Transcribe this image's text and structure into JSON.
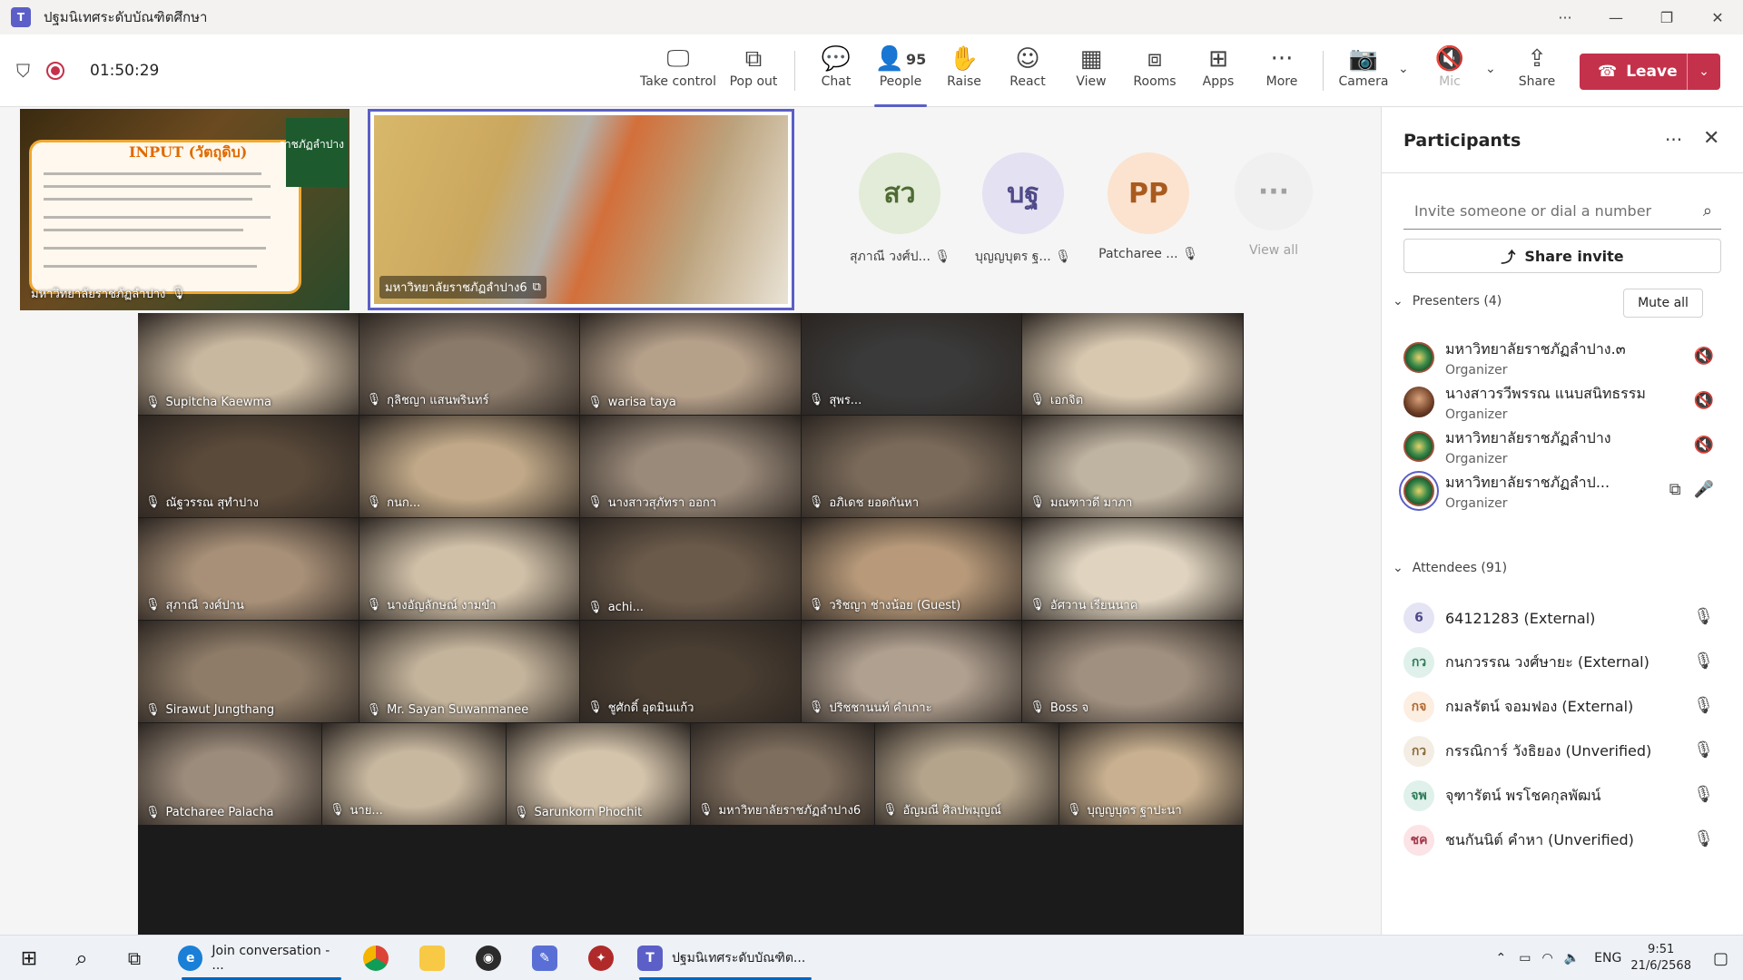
{
  "window": {
    "title": "ปฐมนิเทศระดับบัณฑิตศึกษา",
    "app_icon": "teams-icon"
  },
  "toolbar": {
    "timer": "01:50:29",
    "buttons": [
      {
        "label": "Take control",
        "icon": "take-control-icon"
      },
      {
        "label": "Pop out",
        "icon": "pop-out-icon"
      },
      {
        "label": "Chat",
        "icon": "chat-icon"
      },
      {
        "label": "People",
        "icon": "people-icon",
        "count": "95",
        "active": true
      },
      {
        "label": "Raise",
        "icon": "raise-hand-icon"
      },
      {
        "label": "React",
        "icon": "react-icon"
      },
      {
        "label": "View",
        "icon": "view-icon"
      },
      {
        "label": "Rooms",
        "icon": "rooms-icon"
      },
      {
        "label": "Apps",
        "icon": "apps-icon"
      },
      {
        "label": "More",
        "icon": "more-icon"
      },
      {
        "label": "Camera",
        "icon": "camera-off-icon"
      },
      {
        "label": "Mic",
        "icon": "mic-off-icon",
        "disabled": true
      },
      {
        "label": "Share",
        "icon": "share-icon"
      }
    ],
    "leave_label": "Leave"
  },
  "stage": {
    "share_tile": {
      "name": "มหาวิทยาลัยราชภัฏลำปาง",
      "slide_title": "INPUT (วัตถุดิบ)",
      "logo_text": "ราชภัฏลำปาง"
    },
    "main_tile": {
      "name": "มหาวิทยาลัยราชภัฏลำปาง6"
    },
    "avatar_tiles": [
      {
        "initials": "สว",
        "name": "สุภาณี วงศ์ป...",
        "bg": "#e3ecd8",
        "fg": "#4f6b34"
      },
      {
        "initials": "บฐ",
        "name": "บุญญบุตร ฐ...",
        "bg": "#e4e1f2",
        "fg": "#4f4a88"
      },
      {
        "initials": "PP",
        "name": "Patcharee ...",
        "bg": "#fbe3cf",
        "fg": "#a95a1e"
      },
      {
        "initials": "···",
        "name": "View all",
        "bg": "#f0f0f0",
        "fg": "#a0a0a0"
      }
    ],
    "grid": [
      [
        "Supitcha Kaewma",
        "กุลิชญา แสนพรินทร์",
        "warisa taya",
        "สุพร...",
        "เอกจิต"
      ],
      [
        "ณัฐวรรณ สุทำปาง",
        "กนก...",
        "นางสาวสุภัทรา ออกา",
        "อภิเดช ยอดกันหา",
        "มณฑาวดี มาภา"
      ],
      [
        "สุภาณี วงศ์ปาน",
        "นางอัญลักษณ์ งามขำ",
        "achi...",
        "วริชญา ช่างน้อย (Guest)",
        "อัศวาน เรียนนาค"
      ],
      [
        "Sirawut Jungthang",
        "Mr. Sayan Suwanmanee",
        "ชูศักดิ์ อุดมินแก้ว",
        "ปริชชานนท์ คำเกาะ",
        "Boss จ"
      ],
      [
        "Patcharee Palacha",
        "นาย...",
        "Sarunkorn Phochit",
        "มหาวิทยาลัยราชภัฏลำปาง6",
        "อัญมณี ศิลปพมุญณ์",
        "บุญญบุตร ฐาปะนา"
      ]
    ]
  },
  "panel": {
    "title": "Participants",
    "invite_placeholder": "Invite someone or dial a number",
    "share_invite_label": "Share invite",
    "presenters_header": "Presenters (4)",
    "mute_all_label": "Mute all",
    "presenters": [
      {
        "name": "มหาวิทยาลัยราชภัฏลำปาง.๓",
        "role": "Organizer",
        "avatar": "seal"
      },
      {
        "name": "นางสาวรวีพรรณ แนบสนิทธรรม",
        "role": "Organizer",
        "avatar": "photo"
      },
      {
        "name": "มหาวิทยาลัยราชภัฏลำปาง",
        "role": "Organizer",
        "avatar": "seal"
      },
      {
        "name": "มหาวิทยาลัยราชภัฏลำป...",
        "role": "Organizer",
        "avatar": "seal"
      }
    ],
    "attendees_header": "Attendees (91)",
    "attendees": [
      {
        "initials": "6",
        "name": "64121283 (External)",
        "bg": "#e5e4f5",
        "fg": "#4f4a88"
      },
      {
        "initials": "กว",
        "name": "กนกวรรณ วงศ์ษายะ (External)",
        "bg": "#dff1ea",
        "fg": "#2e7a5a"
      },
      {
        "initials": "กจ",
        "name": "กมลรัตน์ จอมฟอง (External)",
        "bg": "#fdeee2",
        "fg": "#b0672d"
      },
      {
        "initials": "กว",
        "name": "กรรณิการ์ วังธิยอง (Unverified)",
        "bg": "#f4ede4",
        "fg": "#8a6a3a"
      },
      {
        "initials": "จพ",
        "name": "จุฑารัตน์ พรโชคกุลพัฒน์",
        "bg": "#dff1ea",
        "fg": "#2e7a5a"
      },
      {
        "initials": "ชค",
        "name": "ชนกันนิต์ คำหา (Unverified)",
        "bg": "#fbe3e6",
        "fg": "#a4374a"
      }
    ]
  },
  "taskbar": {
    "items": [
      {
        "label": "Join conversation - ...",
        "icon": "edge-icon"
      },
      {
        "label": "",
        "icon": "chrome-icon"
      },
      {
        "label": "",
        "icon": "file-explorer-icon"
      },
      {
        "label": "",
        "icon": "obs-icon"
      },
      {
        "label": "",
        "icon": "app-icon"
      },
      {
        "label": "",
        "icon": "thai-emblem-icon"
      },
      {
        "label": "ปฐมนิเทศระดับบัณฑิต...",
        "icon": "teams-icon"
      }
    ],
    "lang": "ENG",
    "time": "9:51",
    "date": "21/6/2568"
  }
}
